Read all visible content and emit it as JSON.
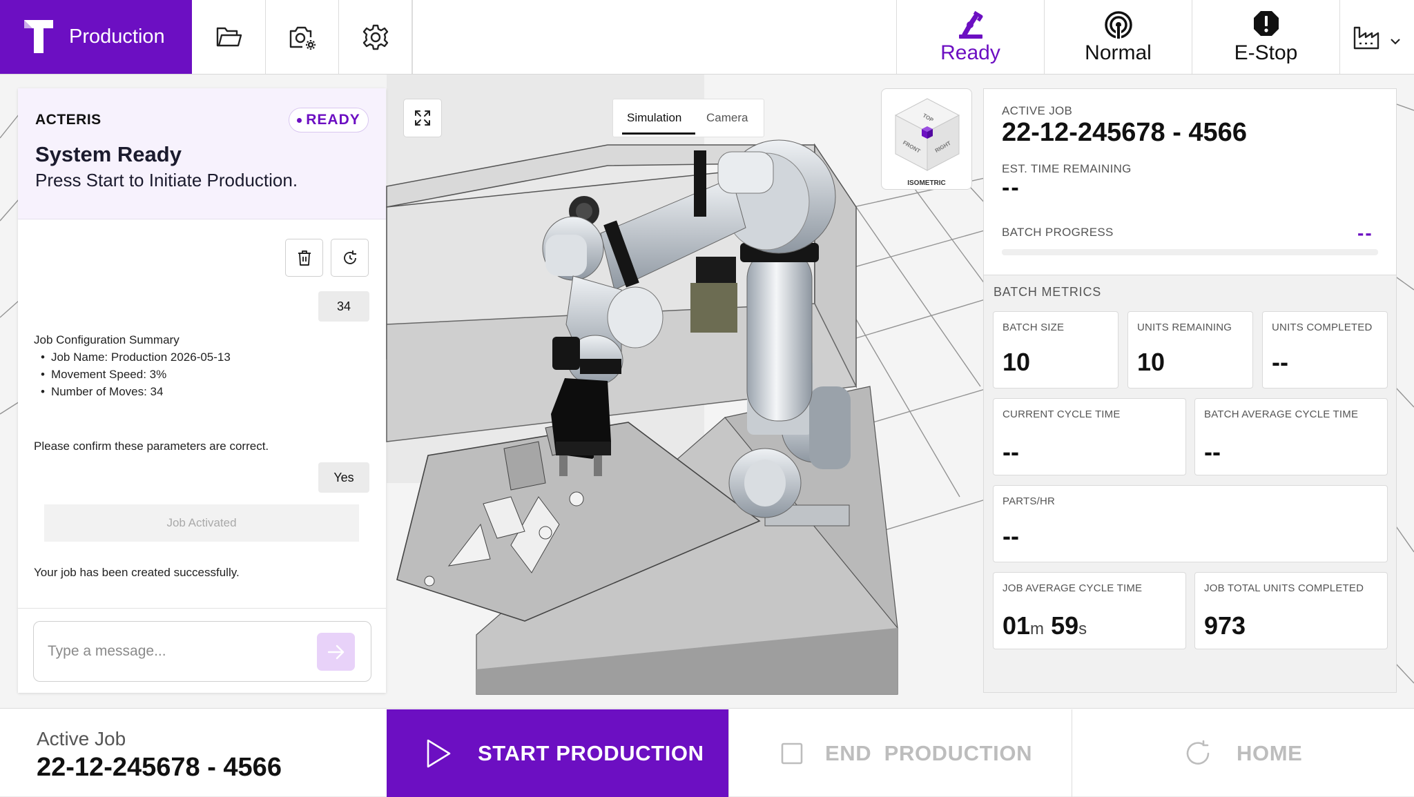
{
  "app": {
    "title": "Production",
    "brand_color": "#6c0fc2"
  },
  "toolbar": {
    "tools": [
      "folder-icon",
      "camera-settings-icon",
      "gear-icon"
    ]
  },
  "status": {
    "ready_label": "Ready",
    "normal_label": "Normal",
    "estop_label": "E-Stop",
    "ready_color": "#6c0fc2"
  },
  "chat": {
    "company": "ACTERIS",
    "badge": "READY",
    "title": "System Ready",
    "subtitle": "Press Start to Initiate Production.",
    "moves_reply": "34",
    "summary_title": "Job Configuration Summary",
    "summary_items": [
      "Job Name: Production 2026-05-13",
      "Movement Speed: 3%",
      "Number of Moves: 34"
    ],
    "confirm_text": "Please confirm these parameters are correct.",
    "yes_reply": "Yes",
    "job_activated": "Job Activated",
    "success_text": "Your job has been created successfully.",
    "input_placeholder": "Type a message..."
  },
  "viewer": {
    "tabs": [
      "Simulation",
      "Camera"
    ],
    "active_tab": "Simulation",
    "cube_label": "ISOMETRIC",
    "cube_faces": {
      "top": "TOP",
      "front": "FRONT",
      "right": "RIGHT"
    }
  },
  "job": {
    "active_job_label": "ACTIVE JOB",
    "active_job_id": "22-12-245678 - 4566",
    "est_time_label": "EST. TIME REMAINING",
    "est_time_value": "--",
    "batch_progress_label": "BATCH PROGRESS",
    "batch_progress_value": "--"
  },
  "metrics": {
    "title": "BATCH METRICS",
    "batch_size": {
      "label": "BATCH SIZE",
      "value": "10"
    },
    "units_remaining": {
      "label": "UNITS REMAINING",
      "value": "10"
    },
    "units_completed": {
      "label": "UNITS COMPLETED",
      "value": "--"
    },
    "current_cycle": {
      "label": "CURRENT CYCLE TIME",
      "value": "--"
    },
    "batch_avg_cycle": {
      "label": "BATCH AVERAGE CYCLE TIME",
      "value": "--"
    },
    "parts_hr": {
      "label": "PARTS/HR",
      "value": "--"
    },
    "job_avg_cycle": {
      "label": "JOB AVERAGE CYCLE TIME",
      "minutes": "01",
      "m_unit": "m",
      "seconds": "59",
      "s_unit": "s"
    },
    "job_total_units": {
      "label": "JOB TOTAL UNITS COMPLETED",
      "value": "973"
    }
  },
  "bottom": {
    "active_job_label": "Active Job",
    "active_job_value": "22-12-245678 - 4566",
    "start_label": "START PRODUCTION",
    "end_label": "END  PRODUCTION",
    "home_label": "HOME"
  }
}
